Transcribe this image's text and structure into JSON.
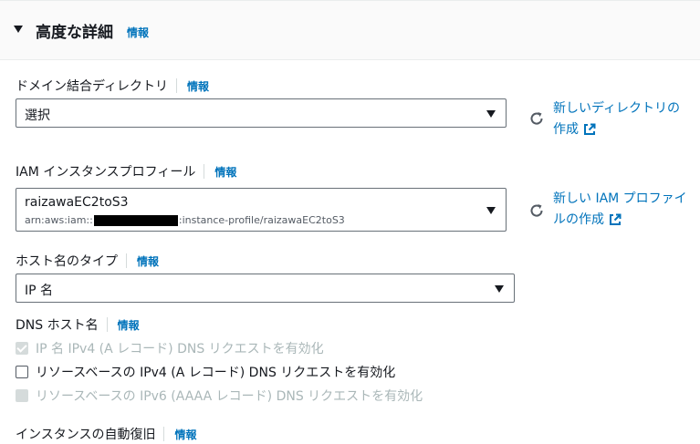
{
  "section": {
    "title": "高度な詳細",
    "info": "情報"
  },
  "domain_join": {
    "label": "ドメイン結合ディレクトリ",
    "info": "情報",
    "value": "選択",
    "create_link_line1": "新しいディレクトリの",
    "create_link_line2": "作成"
  },
  "iam_profile": {
    "label": "IAM インスタンスプロフィール",
    "info": "情報",
    "value": "raizawaEC2toS3",
    "arn_prefix": "arn:aws:iam::",
    "arn_suffix": ":instance-profile/raizawaEC2toS3",
    "create_link_line1": "新しい IAM プロファイ",
    "create_link_line2": "ルの作成"
  },
  "hostname_type": {
    "label": "ホスト名のタイプ",
    "info": "情報",
    "value": "IP 名"
  },
  "dns_hostname": {
    "label": "DNS ホスト名",
    "info": "情報",
    "options": [
      "IP 名 IPv4 (A レコード) DNS リクエストを有効化",
      "リソースベースの IPv4 (A レコード) DNS リクエストを有効化",
      "リソースベースの IPv6 (AAAA レコード) DNS リクエストを有効化"
    ],
    "checked": [
      true,
      false,
      false
    ],
    "disabled": [
      true,
      false,
      true
    ]
  },
  "auto_recovery": {
    "label": "インスタンスの自動復旧",
    "info": "情報"
  },
  "colors": {
    "link": "#0073bb",
    "disabled": "#aab7b8",
    "text": "#16191f"
  }
}
